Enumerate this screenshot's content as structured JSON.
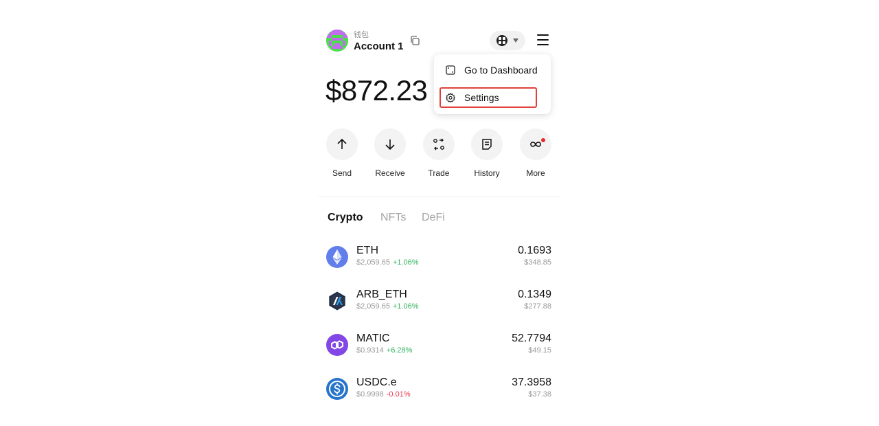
{
  "header": {
    "wallet_label": "钱包",
    "account_name": "Account 1"
  },
  "balance": "$872.23",
  "dropdown": {
    "items": [
      {
        "label": "Go to Dashboard",
        "icon": "dashboard-icon"
      },
      {
        "label": "Settings",
        "icon": "gear-icon",
        "highlighted": true
      }
    ]
  },
  "actions": [
    {
      "label": "Send",
      "icon": "arrow-up-icon"
    },
    {
      "label": "Receive",
      "icon": "arrow-down-icon"
    },
    {
      "label": "Trade",
      "icon": "swap-icon"
    },
    {
      "label": "History",
      "icon": "document-icon"
    },
    {
      "label": "More",
      "icon": "infinity-icon",
      "badge": true
    }
  ],
  "tabs": [
    {
      "label": "Crypto",
      "active": true
    },
    {
      "label": "NFTs",
      "active": false
    },
    {
      "label": "DeFi",
      "active": false
    }
  ],
  "tokens": [
    {
      "symbol": "ETH",
      "price": "$2,059.65",
      "change": "+1.06%",
      "change_color": "#2fb35c",
      "amount": "0.1693",
      "value": "$348.85",
      "logo_color": "#627eea"
    },
    {
      "symbol": "ARB_ETH",
      "price": "$2,059.65",
      "change": "+1.06%",
      "change_color": "#2fb35c",
      "amount": "0.1349",
      "value": "$277.88",
      "logo_color": "#213147"
    },
    {
      "symbol": "MATIC",
      "price": "$0.9314",
      "change": "+6.28%",
      "change_color": "#2fb35c",
      "amount": "52.7794",
      "value": "$49.15",
      "logo_color": "#8247e5"
    },
    {
      "symbol": "USDC.e",
      "price": "$0.9998",
      "change": "-0.01%",
      "change_color": "#e8354d",
      "amount": "37.3958",
      "value": "$37.38",
      "logo_color": "#2775ca"
    }
  ],
  "colors": {
    "highlight_border": "#e0403a",
    "positive": "#2fb35c",
    "negative": "#e8354d"
  }
}
